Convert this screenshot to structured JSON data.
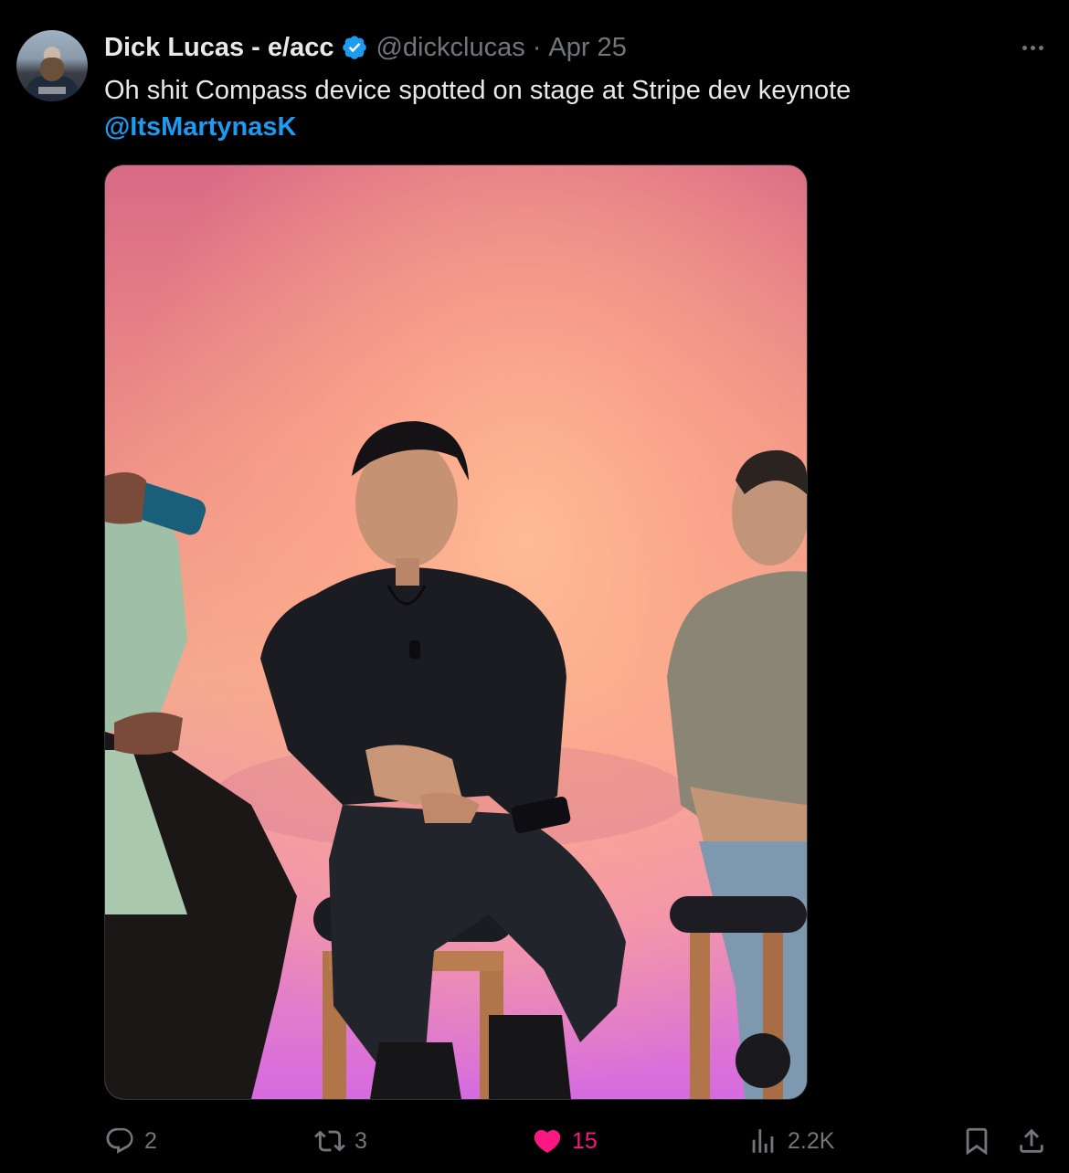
{
  "tweet": {
    "author_name": "Dick Lucas - e/acc",
    "handle": "@dickclucas",
    "separator": "·",
    "date": "Apr 25",
    "text": "Oh shit Compass device spotted on stage at Stripe dev keynote",
    "mention": "@ItsMartynasK"
  },
  "actions": {
    "replies": "2",
    "reposts": "3",
    "likes": "15",
    "views": "2.2K"
  },
  "colors": {
    "background": "#000000",
    "accent": "#1d9bf0",
    "like": "#f91880",
    "muted": "#71767b"
  },
  "icons": [
    "verified-badge-icon",
    "more-icon",
    "reply-icon",
    "repost-icon",
    "heart-icon",
    "views-icon",
    "bookmark-icon",
    "share-icon"
  ]
}
